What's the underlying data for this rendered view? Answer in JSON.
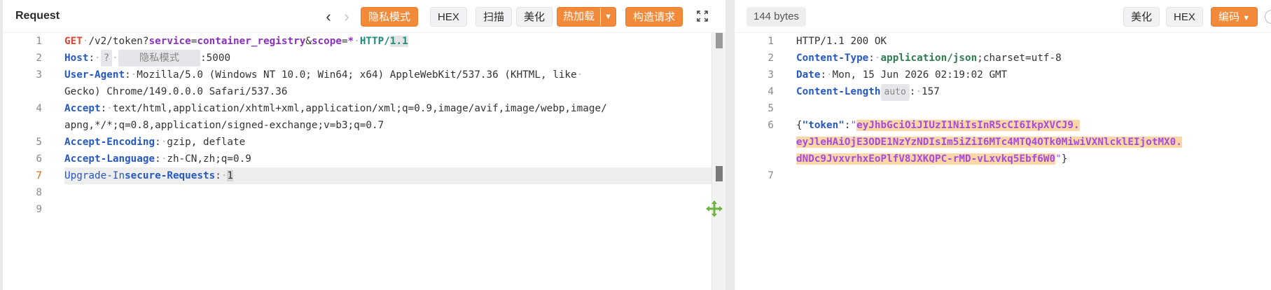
{
  "request": {
    "title": "Request",
    "buttons": {
      "privacy": "隐私模式",
      "hex": "HEX",
      "scan": "扫描",
      "beautify": "美化",
      "hot_load": "热加载",
      "build_request": "构造请求"
    },
    "lines": [
      "1",
      "2",
      "3",
      "4",
      "5",
      "6",
      "7",
      "8",
      "9"
    ],
    "code": {
      "l1": {
        "method": "GET",
        "path": "/v2/token?",
        "p1k": "service",
        "eq": "=",
        "p1v": "container_registry",
        "amp": "&",
        "p2k": "scope",
        "p2v": "*",
        "proto": "HTTP/",
        "ver": "1.1"
      },
      "l2": {
        "key": "Host",
        "sep": ":",
        "q": "?",
        "masked": "隐私模式",
        "port": ":5000"
      },
      "l3": {
        "key": "User-Agent",
        "val": "Mozilla/5.0 (Windows NT 10.0; Win64; x64) AppleWebKit/537.36 (KHTML, like",
        "cont": "Gecko) Chrome/149.0.0.0 Safari/537.36"
      },
      "l4": {
        "key": "Accept",
        "val": "text/html,application/xhtml+xml,application/xml;q=0.9,image/avif,image/webp,image/",
        "cont": "apng,*/*;q=0.8,application/signed-exchange;v=b3;q=0.7"
      },
      "l5": {
        "key": "Accept-Encoding",
        "val": "gzip, deflate"
      },
      "l6": {
        "key": "Accept-Language",
        "val": "zh-CN,zh;q=0.9"
      },
      "l7": {
        "key_a": "Upgrade-In",
        "key_b": "secure-Requests",
        "val": "1"
      }
    }
  },
  "response": {
    "size": "144 bytes",
    "buttons": {
      "beautify": "美化",
      "hex": "HEX",
      "encode": "编码"
    },
    "lines": [
      "1",
      "2",
      "3",
      "4",
      "5",
      "6",
      "7"
    ],
    "code": {
      "l1": "HTTP/1.1 200 OK",
      "l2": {
        "key": "Content-Type",
        "val": "application/json",
        "rest": ";charset=utf-8"
      },
      "l3": {
        "key": "Date",
        "val": "Mon, 15 Jun 2026 02:19:02 GMT"
      },
      "l4": {
        "key": "Content-Length",
        "tag": "auto",
        "val": "157"
      },
      "l6": {
        "open": "{",
        "tkey": "\"token\"",
        "colon": ":",
        "q": "\"",
        "t1": "eyJhbGciOiJIUzI1NiIsInR5cCI6IkpXVCJ9.",
        "t2": "eyJleHAiOjE3ODE1NzYzNDIsIm5iZiI6MTc4MTQ4OTk0MiwiVXNlcklEIjotMX0.",
        "t3": "dNDc9JvxvrhxEoPlfV8JXKQPC-rMD-vLxvkq5Ebf6W0",
        "close": "}"
      }
    }
  },
  "colors": {
    "accent": "#f28a3a",
    "token_highlight": "#fbd7a6"
  }
}
